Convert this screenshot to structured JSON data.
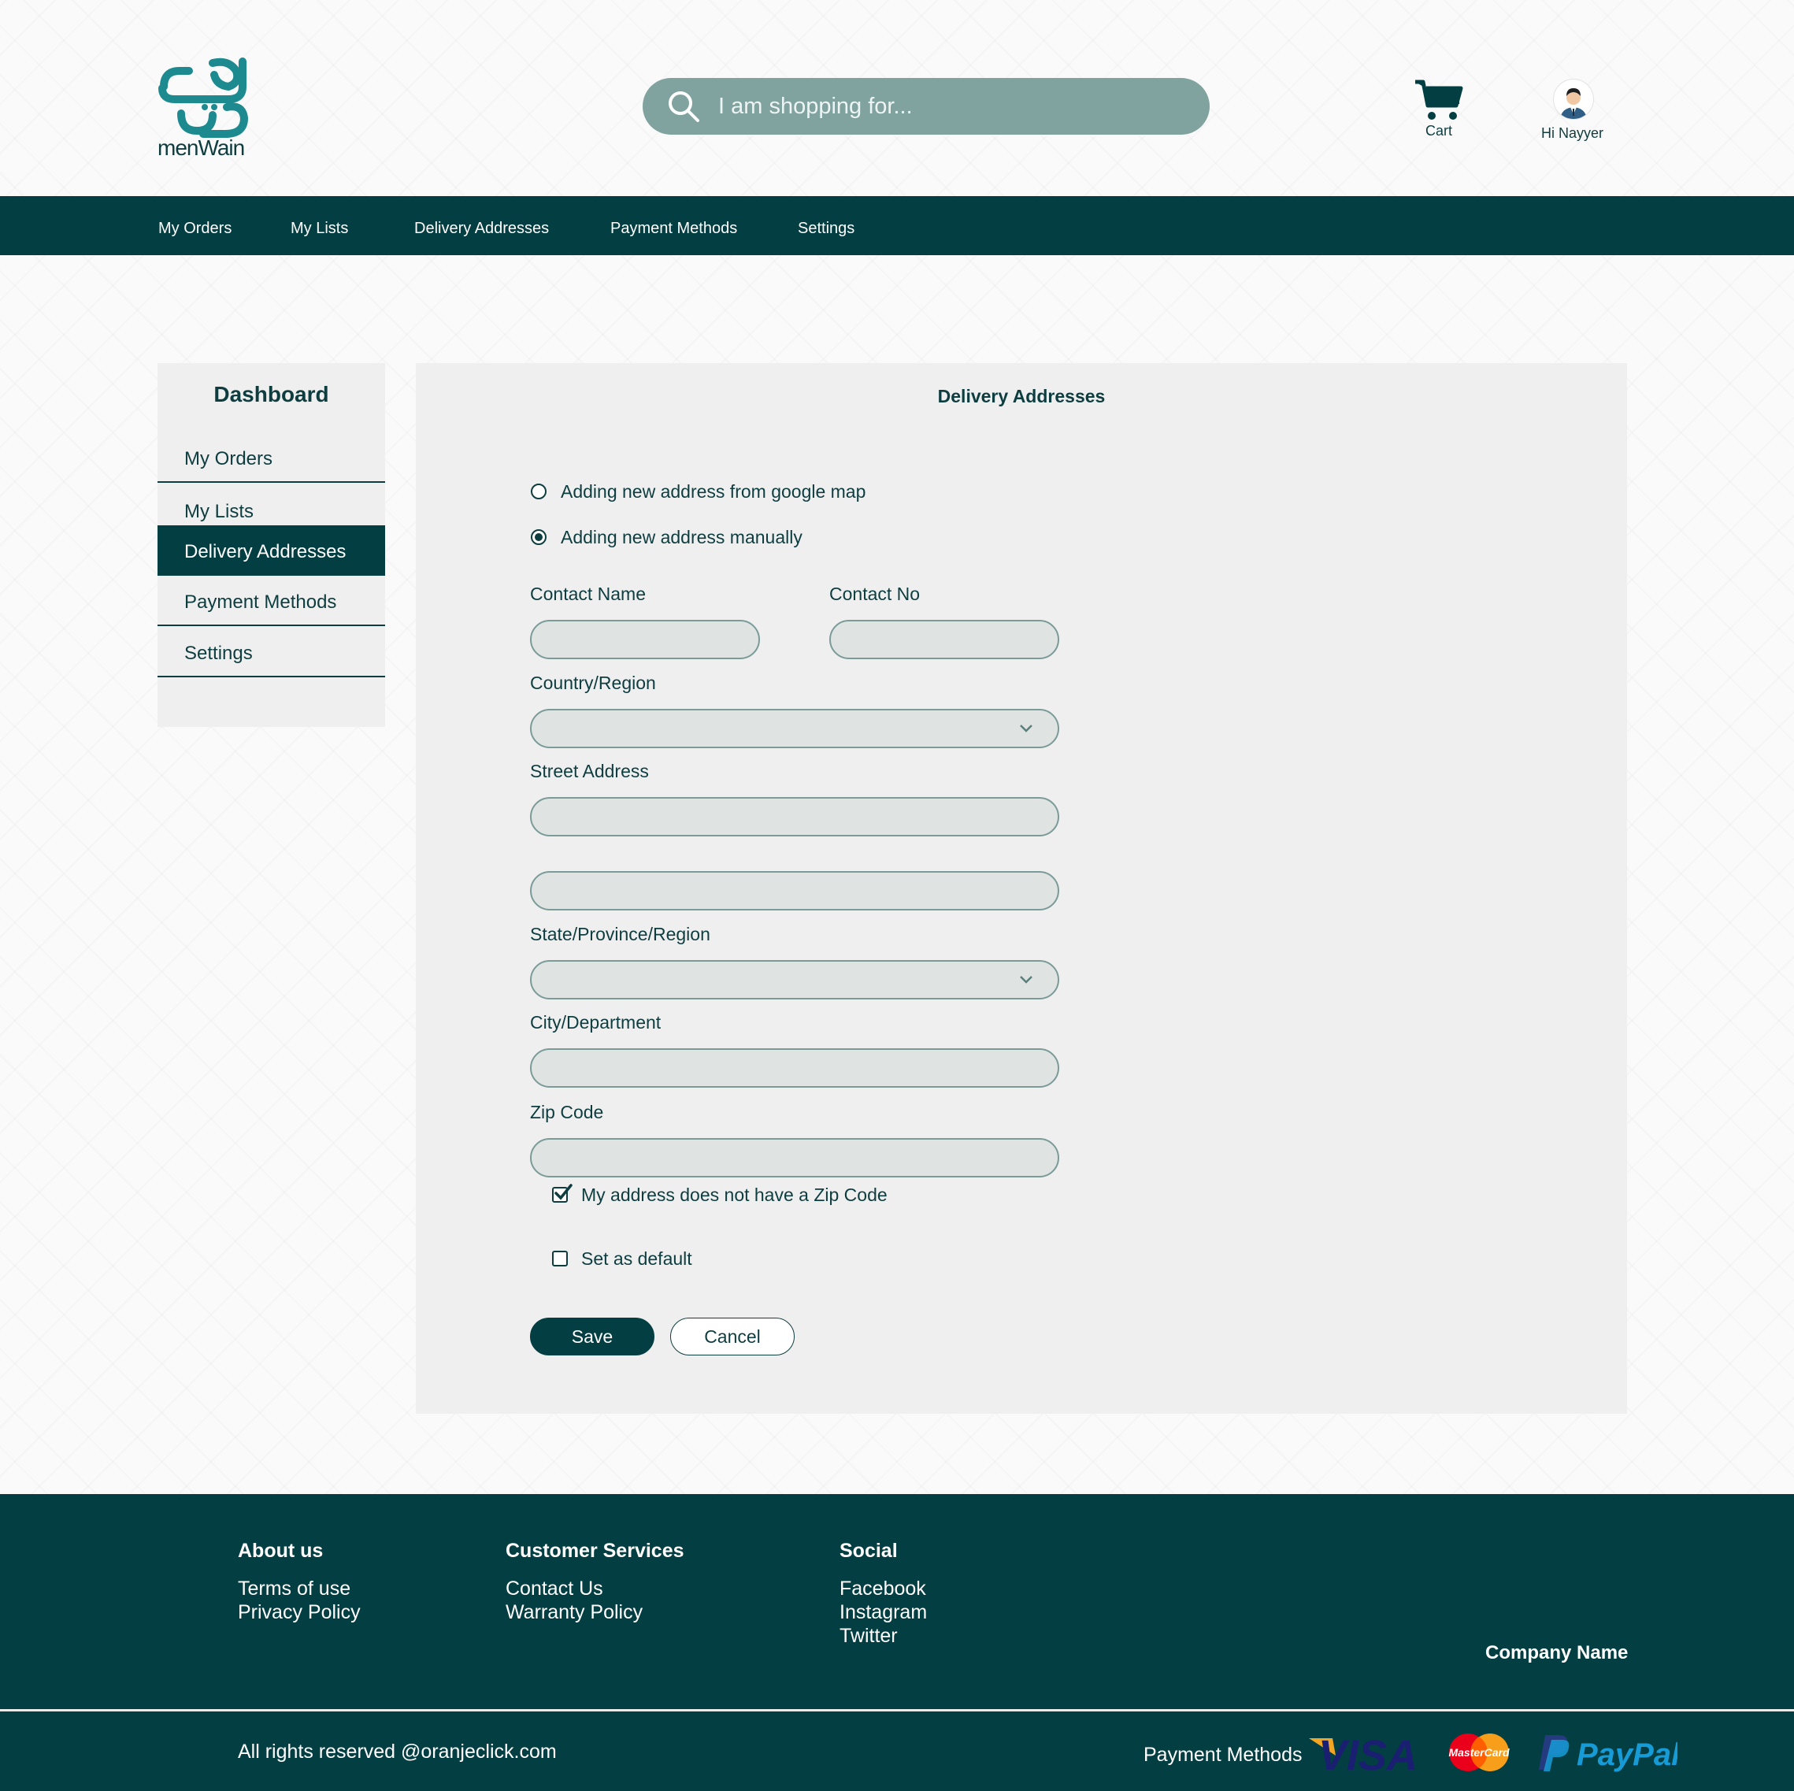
{
  "header": {
    "logo_text": "menWain",
    "search_placeholder": "I am shopping for...",
    "cart_label": "Cart",
    "user_greeting": "Hi Nayyer"
  },
  "nav": {
    "items": [
      "My Orders",
      "My Lists",
      "Delivery Addresses",
      "Payment Methods",
      "Settings"
    ]
  },
  "sidebar": {
    "title": "Dashboard",
    "items": [
      "My Orders",
      "My Lists",
      "Delivery Addresses",
      "Payment Methods",
      "Settings"
    ],
    "active": "Delivery Addresses"
  },
  "form": {
    "title": "Delivery Addresses",
    "option_map": "Adding new address from google map",
    "option_manual": "Adding new address manually",
    "selected_option": "manual",
    "contact_name_label": "Contact Name",
    "contact_no_label": "Contact No",
    "country_label": "Country/Region",
    "street_label": "Street Address",
    "state_label": "State/Province/Region",
    "city_label": "City/Department",
    "zip_label": "Zip Code",
    "no_zip_label": "My address does not have a Zip Code",
    "no_zip_checked": true,
    "default_label": "Set as default",
    "default_checked": false,
    "save_label": "Save",
    "cancel_label": "Cancel"
  },
  "footer": {
    "about_heading": "About us",
    "about_links": [
      "Terms of use",
      "Privacy Policy"
    ],
    "services_heading": "Customer Services",
    "services_links": [
      "Contact Us",
      "Warranty Policy"
    ],
    "social_heading": "Social",
    "social_links": [
      "Facebook",
      "Instagram",
      "Twitter"
    ],
    "company_name": "Company Name",
    "rights": "All rights reserved @oranjeclick.com",
    "payment_label": "Payment Methods",
    "payment_logos": {
      "visa": "VISA",
      "mastercard": "MasterCard",
      "paypal": "PayPal"
    }
  },
  "colors": {
    "primary": "#033e42",
    "search_bg": "#80a3a0",
    "panel_bg": "#efefef",
    "field_bg": "#dfe4e3",
    "logo_teal": "#1d8a90"
  }
}
